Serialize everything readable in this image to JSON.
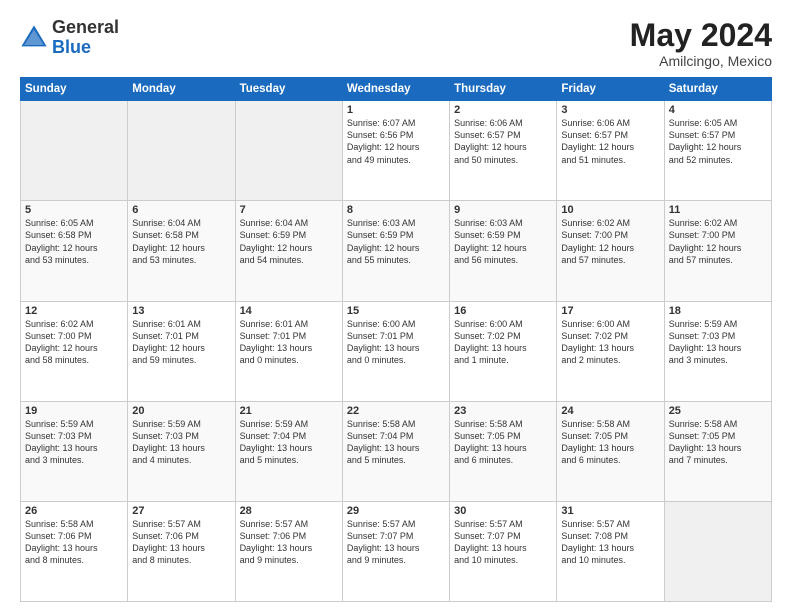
{
  "logo": {
    "general": "General",
    "blue": "Blue"
  },
  "title": "May 2024",
  "subtitle": "Amilcingo, Mexico",
  "headers": [
    "Sunday",
    "Monday",
    "Tuesday",
    "Wednesday",
    "Thursday",
    "Friday",
    "Saturday"
  ],
  "weeks": [
    [
      {
        "num": "",
        "info": ""
      },
      {
        "num": "",
        "info": ""
      },
      {
        "num": "",
        "info": ""
      },
      {
        "num": "1",
        "info": "Sunrise: 6:07 AM\nSunset: 6:56 PM\nDaylight: 12 hours\nand 49 minutes."
      },
      {
        "num": "2",
        "info": "Sunrise: 6:06 AM\nSunset: 6:57 PM\nDaylight: 12 hours\nand 50 minutes."
      },
      {
        "num": "3",
        "info": "Sunrise: 6:06 AM\nSunset: 6:57 PM\nDaylight: 12 hours\nand 51 minutes."
      },
      {
        "num": "4",
        "info": "Sunrise: 6:05 AM\nSunset: 6:57 PM\nDaylight: 12 hours\nand 52 minutes."
      }
    ],
    [
      {
        "num": "5",
        "info": "Sunrise: 6:05 AM\nSunset: 6:58 PM\nDaylight: 12 hours\nand 53 minutes."
      },
      {
        "num": "6",
        "info": "Sunrise: 6:04 AM\nSunset: 6:58 PM\nDaylight: 12 hours\nand 53 minutes."
      },
      {
        "num": "7",
        "info": "Sunrise: 6:04 AM\nSunset: 6:59 PM\nDaylight: 12 hours\nand 54 minutes."
      },
      {
        "num": "8",
        "info": "Sunrise: 6:03 AM\nSunset: 6:59 PM\nDaylight: 12 hours\nand 55 minutes."
      },
      {
        "num": "9",
        "info": "Sunrise: 6:03 AM\nSunset: 6:59 PM\nDaylight: 12 hours\nand 56 minutes."
      },
      {
        "num": "10",
        "info": "Sunrise: 6:02 AM\nSunset: 7:00 PM\nDaylight: 12 hours\nand 57 minutes."
      },
      {
        "num": "11",
        "info": "Sunrise: 6:02 AM\nSunset: 7:00 PM\nDaylight: 12 hours\nand 57 minutes."
      }
    ],
    [
      {
        "num": "12",
        "info": "Sunrise: 6:02 AM\nSunset: 7:00 PM\nDaylight: 12 hours\nand 58 minutes."
      },
      {
        "num": "13",
        "info": "Sunrise: 6:01 AM\nSunset: 7:01 PM\nDaylight: 12 hours\nand 59 minutes."
      },
      {
        "num": "14",
        "info": "Sunrise: 6:01 AM\nSunset: 7:01 PM\nDaylight: 13 hours\nand 0 minutes."
      },
      {
        "num": "15",
        "info": "Sunrise: 6:00 AM\nSunset: 7:01 PM\nDaylight: 13 hours\nand 0 minutes."
      },
      {
        "num": "16",
        "info": "Sunrise: 6:00 AM\nSunset: 7:02 PM\nDaylight: 13 hours\nand 1 minute."
      },
      {
        "num": "17",
        "info": "Sunrise: 6:00 AM\nSunset: 7:02 PM\nDaylight: 13 hours\nand 2 minutes."
      },
      {
        "num": "18",
        "info": "Sunrise: 5:59 AM\nSunset: 7:03 PM\nDaylight: 13 hours\nand 3 minutes."
      }
    ],
    [
      {
        "num": "19",
        "info": "Sunrise: 5:59 AM\nSunset: 7:03 PM\nDaylight: 13 hours\nand 3 minutes."
      },
      {
        "num": "20",
        "info": "Sunrise: 5:59 AM\nSunset: 7:03 PM\nDaylight: 13 hours\nand 4 minutes."
      },
      {
        "num": "21",
        "info": "Sunrise: 5:59 AM\nSunset: 7:04 PM\nDaylight: 13 hours\nand 5 minutes."
      },
      {
        "num": "22",
        "info": "Sunrise: 5:58 AM\nSunset: 7:04 PM\nDaylight: 13 hours\nand 5 minutes."
      },
      {
        "num": "23",
        "info": "Sunrise: 5:58 AM\nSunset: 7:05 PM\nDaylight: 13 hours\nand 6 minutes."
      },
      {
        "num": "24",
        "info": "Sunrise: 5:58 AM\nSunset: 7:05 PM\nDaylight: 13 hours\nand 6 minutes."
      },
      {
        "num": "25",
        "info": "Sunrise: 5:58 AM\nSunset: 7:05 PM\nDaylight: 13 hours\nand 7 minutes."
      }
    ],
    [
      {
        "num": "26",
        "info": "Sunrise: 5:58 AM\nSunset: 7:06 PM\nDaylight: 13 hours\nand 8 minutes."
      },
      {
        "num": "27",
        "info": "Sunrise: 5:57 AM\nSunset: 7:06 PM\nDaylight: 13 hours\nand 8 minutes."
      },
      {
        "num": "28",
        "info": "Sunrise: 5:57 AM\nSunset: 7:06 PM\nDaylight: 13 hours\nand 9 minutes."
      },
      {
        "num": "29",
        "info": "Sunrise: 5:57 AM\nSunset: 7:07 PM\nDaylight: 13 hours\nand 9 minutes."
      },
      {
        "num": "30",
        "info": "Sunrise: 5:57 AM\nSunset: 7:07 PM\nDaylight: 13 hours\nand 10 minutes."
      },
      {
        "num": "31",
        "info": "Sunrise: 5:57 AM\nSunset: 7:08 PM\nDaylight: 13 hours\nand 10 minutes."
      },
      {
        "num": "",
        "info": ""
      }
    ]
  ]
}
